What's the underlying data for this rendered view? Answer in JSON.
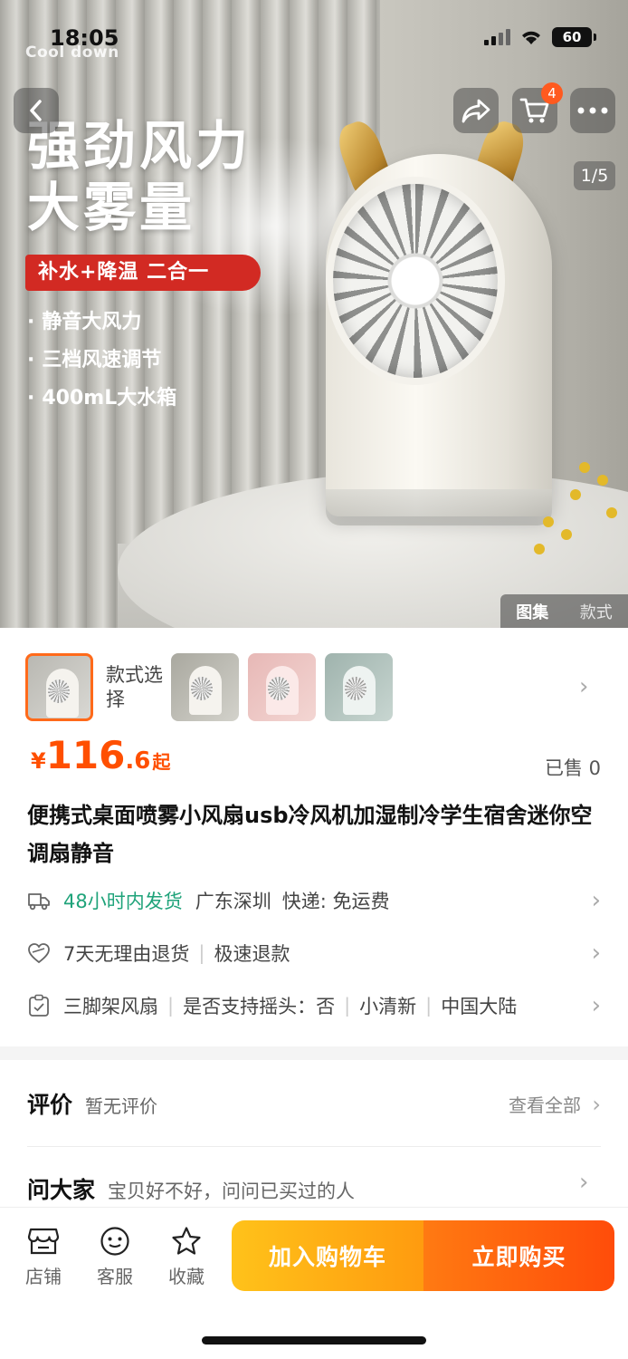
{
  "status_bar": {
    "time": "18:05",
    "battery": "60"
  },
  "hero": {
    "logo_text": "Cool down",
    "headline_line1": "强劲风力",
    "headline_line2": "大雾量",
    "badge": "补水+降温 二合一",
    "bullets": [
      "静音大风力",
      "三档风速调节",
      "400mL大水箱"
    ],
    "page_indicator": "1/5",
    "gallery_tab_active": "图集",
    "gallery_tab_inactive": "款式"
  },
  "nav": {
    "cart_count": "4"
  },
  "product": {
    "style_select_label": "款式选择",
    "price_currency": "¥",
    "price_int": "116",
    "price_dec": ".6",
    "price_suffix": "起",
    "sold": "已售 0",
    "title": "便携式桌面喷雾小风扇usb冷风机加湿制冷学生宿舍迷你空调扇静音",
    "shipping": {
      "highlight": "48小时内发货",
      "origin": "广东深圳",
      "express": "快递: 免运费"
    },
    "service": {
      "return_policy": "7天无理由退货",
      "refund": "极速退款"
    },
    "params": [
      "三脚架风扇",
      "是否支持摇头：否",
      "小清新",
      "中国大陆"
    ]
  },
  "reviews": {
    "title": "评价",
    "status": "暂无评价",
    "view_all": "查看全部",
    "ask_title": "问大家",
    "ask_hint": "宝贝好不好，问问已买过的人"
  },
  "bottom_bar": {
    "shop": "店铺",
    "service": "客服",
    "favorite": "收藏",
    "add_to_cart": "加入购物车",
    "buy_now": "立即购买"
  },
  "colors": {
    "accent": "#ff5a1f",
    "price": "#ff4f00",
    "shipping_green": "#1fa37a",
    "cart_button": "#ffa814",
    "buy_button": "#ff5a0d"
  }
}
